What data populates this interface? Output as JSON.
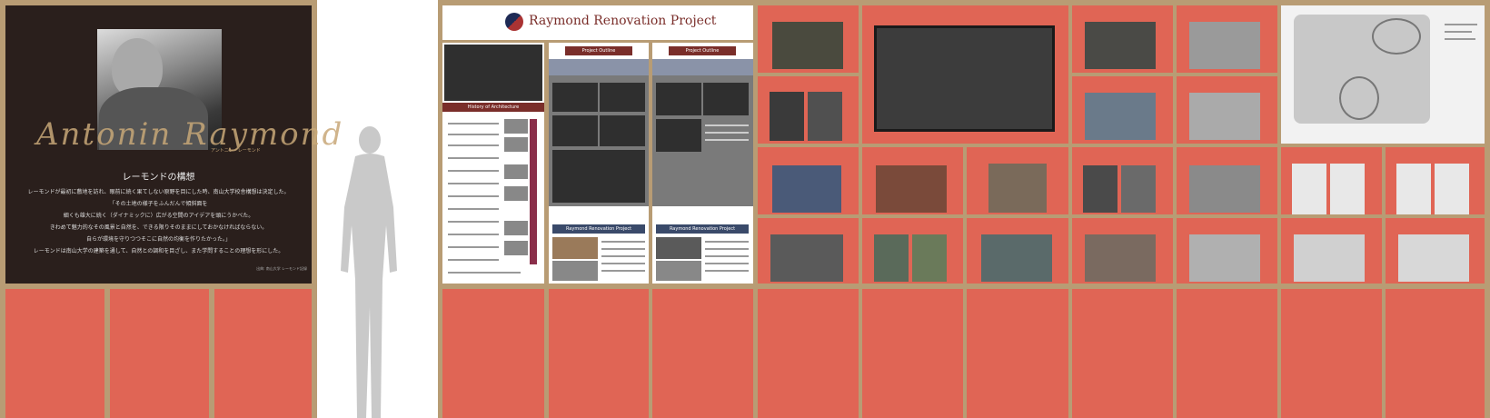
{
  "left_panel": {
    "signature": "Antonin Raymond",
    "signature_sub": "アントニン・レーモンド",
    "concept_title": "レーモンドの構想",
    "concept_lines": [
      "レーモンドが最初に敷地を訪れ、眼前に続く果てしない原野を目にした時、南山大学校舎構想は決定した。",
      "「その土地の様子をふんだんで傾斜面を",
      "細くも雄大に続く（ダイナミックに）広がる空間のアイデアを頭にうかべた。",
      "きわめて魅力的なその風景と自然を、できる限りそのままにしておかなければならない。",
      "自らが環境を守りつつそこに自然の均衡を作りたかった。」",
      "レーモンドは南山大学の建築を通して、自然との調和を目ざし、また学問することの理想を形にした。"
    ],
    "concept_source": "出典: 南山大学 レーモンド記録"
  },
  "right_wall": {
    "project_title": "Raymond Renovation Project",
    "poster_labels": {
      "history": "History of Architecture",
      "outline_1": "Project Outline",
      "outline_2": "Project Outline",
      "renovation_1": "Raymond Renovation Project",
      "renovation_2": "Raymond Renovation Project"
    }
  },
  "colors": {
    "wall_frame": "#b89c74",
    "panel_red": "#e06555",
    "dark_panel": "#2a1f1c",
    "accent": "#7a2e2a"
  }
}
